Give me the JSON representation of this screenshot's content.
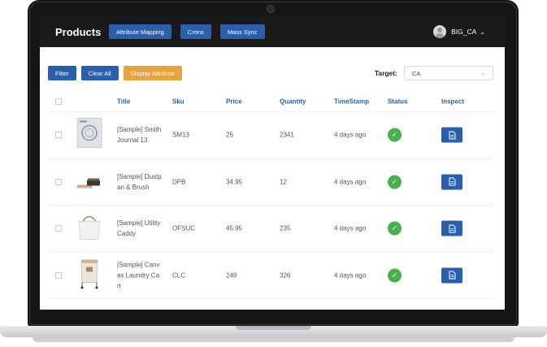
{
  "app": {
    "title": "Products",
    "nav_buttons": [
      "Attribute Mapping",
      "Crons",
      "Mass Sync"
    ],
    "user_name": "BIG_CA",
    "user_chevron": "⌄"
  },
  "toolbar": {
    "filter_label": "Filter",
    "clear_label": "Clear All",
    "display_label": "Display Attribute",
    "target_label": "Target:",
    "target_value": "CA",
    "target_caret": "⌄"
  },
  "table": {
    "headers": {
      "title": "Title",
      "sku": "Sku",
      "price": "Price",
      "quantity": "Quantity",
      "timestamp": "TimeStamp",
      "status": "Status",
      "inspect": "Inspect"
    },
    "rows": [
      {
        "title_line1": "[Sample] Smith",
        "title_line2": "Journal 13",
        "sku": "SM13",
        "price": "25",
        "quantity": "2341",
        "timestamp": "4 days ago",
        "image_icon": "journal-icon"
      },
      {
        "title_line1": "[Sample] Dustp",
        "title_line2": "an & Brush",
        "sku": "DPB",
        "price": "34.95",
        "quantity": "12",
        "timestamp": "4 days ago",
        "image_icon": "dustpan-icon"
      },
      {
        "title_line1": "[Sample] Utility",
        "title_line2": "Caddy",
        "sku": "OFSUC",
        "price": "45.95",
        "quantity": "235",
        "timestamp": "4 days ago",
        "image_icon": "caddy-icon"
      },
      {
        "title_line1": "[Sample] Canv",
        "title_line2": "as Laundry Ca",
        "title_line3": "rt",
        "sku": "CLC",
        "price": "249",
        "quantity": "326",
        "timestamp": "4 days ago",
        "image_icon": "laundry-cart-icon"
      }
    ],
    "status_glyph": "✓"
  },
  "colors": {
    "accent_blue": "#2a5fb0",
    "accent_orange": "#e8a33c",
    "status_green": "#48b04c",
    "topbar": "#1a1a1a"
  }
}
